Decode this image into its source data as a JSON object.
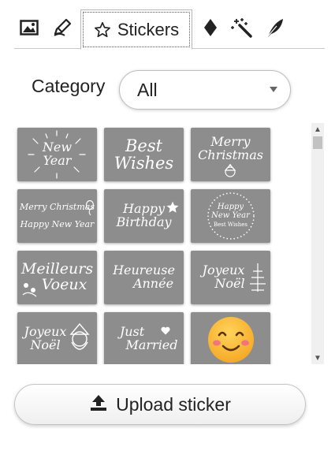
{
  "tabs": {
    "image_icon": "image-icon",
    "draw_icon": "pencil-icon",
    "stickers_label": "Stickers",
    "stickers_icon": "star-icon",
    "shape_icon": "diamond-icon",
    "magic_icon": "magic-wand-icon",
    "feather_icon": "feather-icon"
  },
  "category": {
    "label": "Category",
    "selected": "All"
  },
  "stickers": [
    {
      "lines": [
        "New",
        "Year"
      ],
      "decor": "sparkle-burst"
    },
    {
      "lines": [
        "Best",
        "Wishes"
      ],
      "decor": "none"
    },
    {
      "lines": [
        "Merry",
        "Christmas"
      ],
      "decor": "santa"
    },
    {
      "lines": [
        "Merry Christmas",
        "Happy New Year"
      ],
      "decor": "balloon"
    },
    {
      "lines": [
        "Happy",
        "Birthday"
      ],
      "decor": "star"
    },
    {
      "lines": [
        "Happy",
        "New Year",
        "Best Wishes"
      ],
      "decor": "dotted-circle"
    },
    {
      "lines": [
        "Meilleurs",
        "Voeux"
      ],
      "decor": "flowers"
    },
    {
      "lines": [
        "Heureuse",
        "Année"
      ],
      "decor": "none"
    },
    {
      "lines": [
        "Joyeux",
        "Noël"
      ],
      "decor": "tree"
    },
    {
      "lines": [
        "Joyeux",
        "Noël"
      ],
      "decor": "santa"
    },
    {
      "lines": [
        "Just",
        "Married"
      ],
      "decor": "heart"
    },
    {
      "lines": [],
      "decor": "smiling-face-emoji"
    }
  ],
  "upload": {
    "label": "Upload sticker",
    "icon": "upload-icon"
  },
  "colors": {
    "sticker_bg": "#8d8d8d",
    "emoji_face": "#f7b731",
    "emoji_blush": "#ef6a86"
  }
}
